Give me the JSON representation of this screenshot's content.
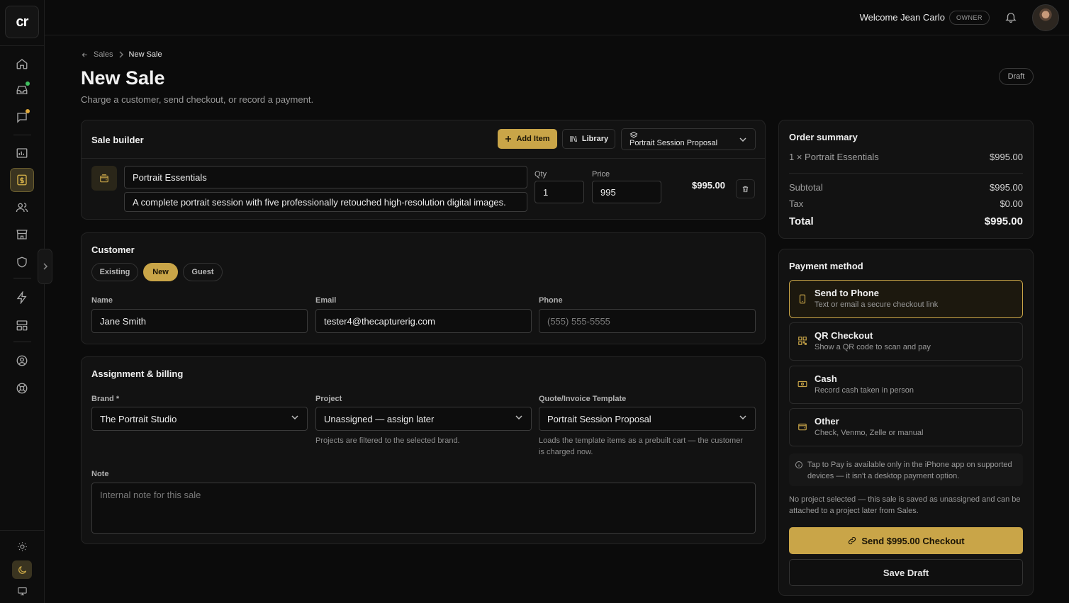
{
  "app": {
    "logo_text": "cr"
  },
  "topbar": {
    "welcome": "Welcome Jean Carlo",
    "role_badge": "OWNER"
  },
  "breadcrumb": {
    "parent": "Sales",
    "current": "New Sale"
  },
  "header": {
    "title": "New Sale",
    "subtitle": "Charge a customer, send checkout, or record a payment.",
    "status_badge": "Draft"
  },
  "sale_builder": {
    "title": "Sale builder",
    "add_item_label": "Add Item",
    "library_label": "Library",
    "template_select": "Portrait Session Proposal",
    "item": {
      "name": "Portrait Essentials",
      "description": "A complete portrait session with five professionally retouched high-resolution digital images.",
      "qty_label": "Qty",
      "qty": "1",
      "price_label": "Price",
      "price": "995",
      "line_total": "$995.00"
    }
  },
  "customer": {
    "title": "Customer",
    "tabs": [
      {
        "label": "Existing",
        "active": false
      },
      {
        "label": "New",
        "active": true
      },
      {
        "label": "Guest",
        "active": false
      }
    ],
    "name_label": "Name",
    "name_value": "Jane Smith",
    "email_label": "Email",
    "email_value": "tester4@thecapturerig.com",
    "phone_label": "Phone",
    "phone_placeholder": "(555) 555-5555"
  },
  "assignment": {
    "title": "Assignment & billing",
    "brand_label": "Brand *",
    "brand_value": "The Portrait Studio",
    "project_label": "Project",
    "project_value": "Unassigned — assign later",
    "project_help": "Projects are filtered to the selected brand.",
    "template_label": "Quote/Invoice Template",
    "template_value": "Portrait Session Proposal",
    "template_help": "Loads the template items as a prebuilt cart — the customer is charged now.",
    "note_label": "Note",
    "note_placeholder": "Internal note for this sale"
  },
  "order_summary": {
    "title": "Order summary",
    "line_label": "1 × Portrait Essentials",
    "line_value": "$995.00",
    "subtotal_label": "Subtotal",
    "subtotal_value": "$995.00",
    "tax_label": "Tax",
    "tax_value": "$0.00",
    "total_label": "Total",
    "total_value": "$995.00"
  },
  "payment": {
    "title": "Payment method",
    "options": [
      {
        "title": "Send to Phone",
        "subtitle": "Text or email a secure checkout link",
        "icon": "phone-icon",
        "selected": true
      },
      {
        "title": "QR Checkout",
        "subtitle": "Show a QR code to scan and pay",
        "icon": "qr-icon",
        "selected": false
      },
      {
        "title": "Cash",
        "subtitle": "Record cash taken in person",
        "icon": "cash-icon",
        "selected": false
      },
      {
        "title": "Other",
        "subtitle": "Check, Venmo, Zelle or manual",
        "icon": "wallet-icon",
        "selected": false
      }
    ],
    "tap_info": "Tap to Pay is available only in the iPhone app on supported devices — it isn't a desktop payment option.",
    "project_note": "No project selected — this sale is saved as unassigned and can be attached to a project later from Sales.",
    "send_button": "Send $995.00 Checkout",
    "save_button": "Save Draft"
  },
  "colors": {
    "accent": "#c9a548",
    "background": "#0b0b0b",
    "card": "#121212",
    "notify_green": "#3fbf5f",
    "notify_amber": "#e0a93a"
  }
}
